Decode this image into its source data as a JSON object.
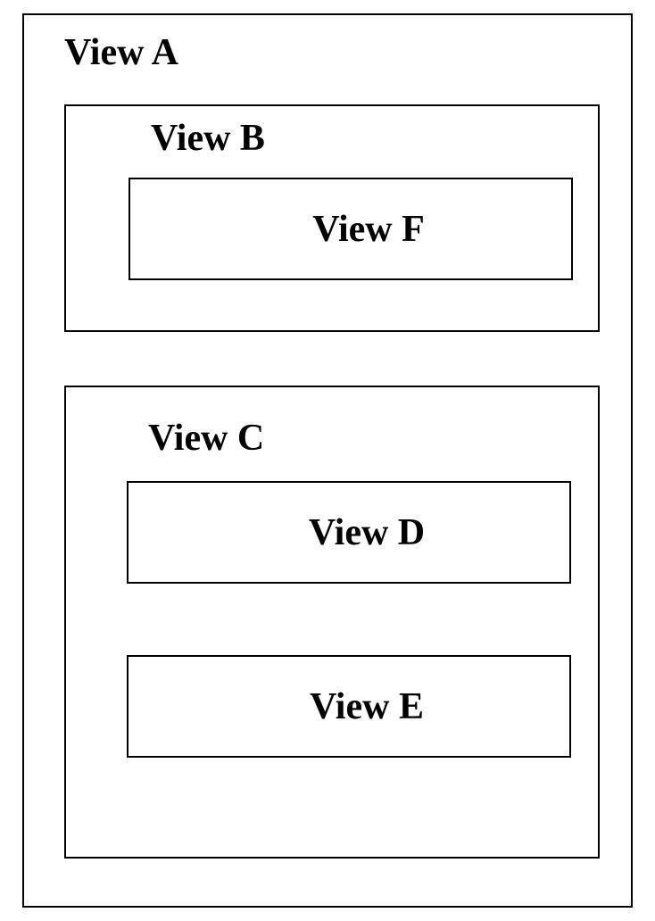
{
  "views": {
    "a": {
      "label": "View A"
    },
    "b": {
      "label": "View B"
    },
    "c": {
      "label": "View C"
    },
    "d": {
      "label": "View D"
    },
    "e": {
      "label": "View E"
    },
    "f": {
      "label": "View F"
    }
  },
  "hierarchy": {
    "root": "A",
    "children": {
      "A": [
        "B",
        "C"
      ],
      "B": [
        "F"
      ],
      "C": [
        "D",
        "E"
      ]
    }
  }
}
